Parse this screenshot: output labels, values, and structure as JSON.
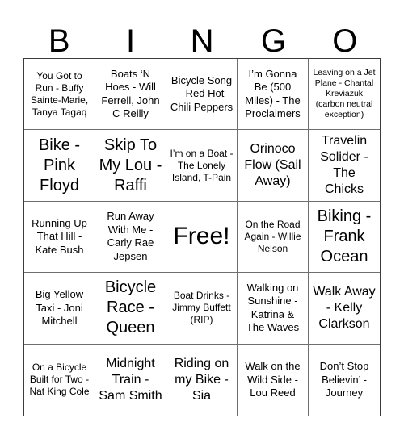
{
  "header": {
    "letters": [
      "B",
      "I",
      "N",
      "G",
      "O"
    ]
  },
  "grid": {
    "rows": 5,
    "columns": 5,
    "cells": [
      {
        "text": "You Got to Run - Buffy Sainte-Marie, Tanya Tagaq",
        "size": "sm",
        "free": false
      },
      {
        "text": "Boats ‘N Hoes - Will Ferrell, John C Reilly",
        "size": "md",
        "free": false
      },
      {
        "text": "Bicycle Song - Red Hot Chili Peppers",
        "size": "md",
        "free": false
      },
      {
        "text": "I’m Gonna Be (500 Miles) - The Proclaimers",
        "size": "md",
        "free": false
      },
      {
        "text": "Leaving on a Jet Plane - Chantal Kreviazuk (carbon neutral exception)",
        "size": "xs",
        "free": false
      },
      {
        "text": "Bike - Pink Floyd",
        "size": "xl",
        "free": false
      },
      {
        "text": "Skip To My Lou - Raffi",
        "size": "xl",
        "free": false
      },
      {
        "text": "I’m on a Boat - The Lonely Island, T-Pain",
        "size": "sm",
        "free": false
      },
      {
        "text": "Orinoco Flow (Sail Away)",
        "size": "lg",
        "free": false
      },
      {
        "text": "Travelin Solider - The Chicks",
        "size": "lg",
        "free": false
      },
      {
        "text": "Running Up That Hill - Kate Bush",
        "size": "md",
        "free": false
      },
      {
        "text": "Run Away With Me - Carly Rae Jepsen",
        "size": "md",
        "free": false
      },
      {
        "text": "Free!",
        "size": "free",
        "free": true
      },
      {
        "text": "On the Road Again - Willie Nelson",
        "size": "sm",
        "free": false
      },
      {
        "text": "Biking - Frank Ocean",
        "size": "xl",
        "free": false
      },
      {
        "text": "Big Yellow Taxi - Joni Mitchell",
        "size": "md",
        "free": false
      },
      {
        "text": "Bicycle Race - Queen",
        "size": "xl",
        "free": false
      },
      {
        "text": "Boat Drinks - Jimmy Buffett (RIP)",
        "size": "sm",
        "free": false
      },
      {
        "text": "Walking on Sunshine - Katrina & The Waves",
        "size": "md",
        "free": false
      },
      {
        "text": "Walk Away - Kelly Clarkson",
        "size": "lg",
        "free": false
      },
      {
        "text": "On a Bicycle Built for Two - Nat King Cole",
        "size": "sm",
        "free": false
      },
      {
        "text": "Midnight Train - Sam Smith",
        "size": "lg",
        "free": false
      },
      {
        "text": "Riding on my Bike - Sia",
        "size": "lg",
        "free": false
      },
      {
        "text": "Walk on the Wild Side - Lou Reed",
        "size": "md",
        "free": false
      },
      {
        "text": "Don’t Stop Believin’ - Journey",
        "size": "md",
        "free": false
      }
    ]
  },
  "colors": {
    "background": "#ffffff",
    "text": "#000000",
    "grid_line": "#6e6e6e",
    "grid_outer": "#3c3c3c"
  }
}
